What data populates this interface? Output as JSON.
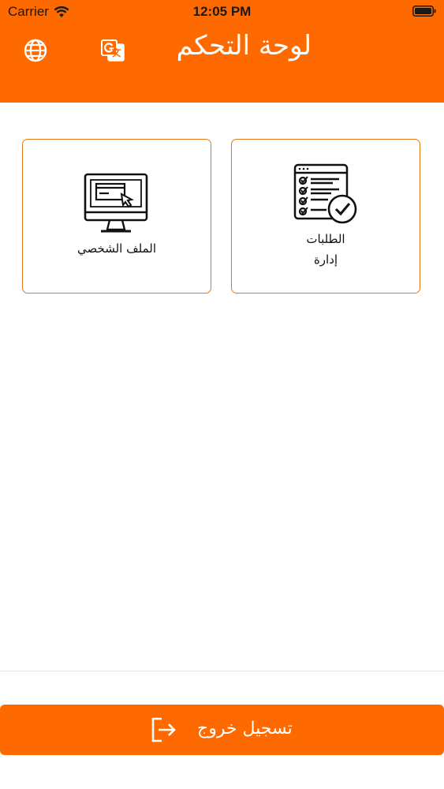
{
  "status_bar": {
    "carrier": "Carrier",
    "time": "12:05 PM"
  },
  "header": {
    "title": "لوحة التحكم",
    "background_color": "#ff6a00",
    "icons": [
      "globe-icon",
      "google-translate-icon"
    ]
  },
  "cards": [
    {
      "id": "orders",
      "icon": "checklist-check-icon",
      "label_line1": "الطلبات",
      "label_line2": "إدارة"
    },
    {
      "id": "profile",
      "icon": "monitor-cursor-icon",
      "label_line1": "الملف الشخصي"
    }
  ],
  "footer": {
    "logout_label": "تسجيل خروج",
    "logout_icon": "logout-icon"
  },
  "colors": {
    "accent": "#ff6a00",
    "card_border": "#e07a18"
  }
}
